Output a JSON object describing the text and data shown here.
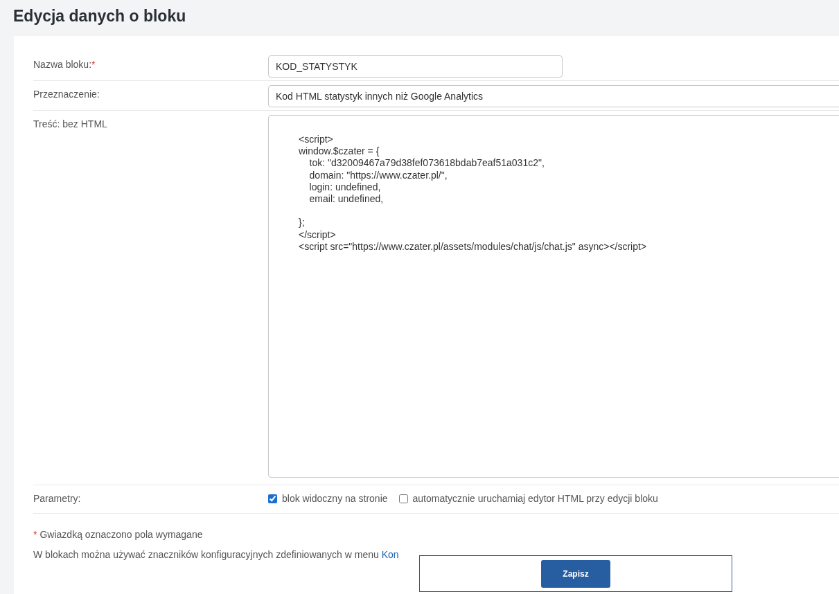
{
  "page_title": "Edycja danych o bloku",
  "fields": [
    {
      "kind": "input",
      "label": "Nazwa bloku:",
      "required_mark": "*",
      "value": "KOD_STATYSTYK"
    },
    {
      "kind": "wideinput",
      "label": "Przeznaczenie:",
      "value": "Kod HTML statystyk innych niż Google Analytics"
    },
    {
      "kind": "textarea",
      "label": "Treść: bez HTML",
      "value": "<script>\nwindow.$czater = {\n    tok: \"d32009467a79d38fef073618bdab7eaf51a031c2\",\n    domain: \"https://www.czater.pl/\",\n    login: undefined,\n    email: undefined,\n\n};\n</script>\n<script src=\"https://www.czater.pl/assets/modules/chat/js/chat.js\" async></script>"
    },
    {
      "kind": "checkboxes",
      "label": "Parametry:",
      "options": [
        {
          "label": "blok widoczny na stronie",
          "checked": true
        },
        {
          "label": "automatycznie uruchamiaj edytor HTML przy edycji bloku",
          "checked": false
        }
      ]
    }
  ],
  "required_note": {
    "mark": "*",
    "text": "Gwiazdką oznaczono pola wymagane"
  },
  "info": {
    "text": "W blokach można używać znaczników konfiguracyjnych zdefiniowanych w menu ",
    "link": "Kon"
  },
  "save_button": "Zapisz"
}
